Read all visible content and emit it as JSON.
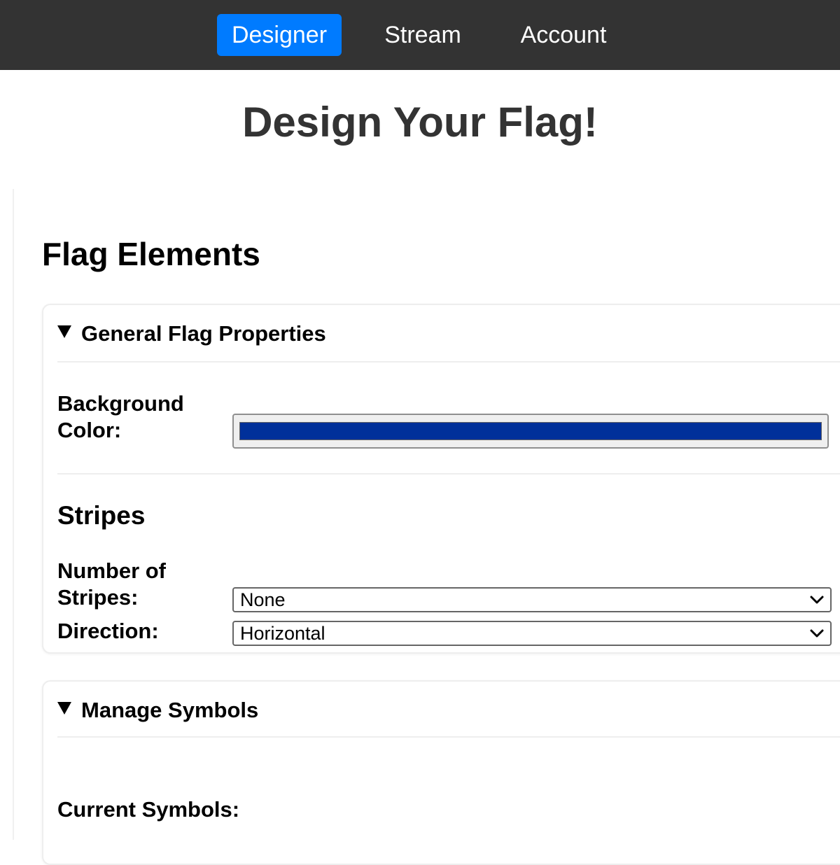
{
  "nav": {
    "items": [
      {
        "label": "Designer",
        "active": true
      },
      {
        "label": "Stream",
        "active": false
      },
      {
        "label": "Account",
        "active": false
      }
    ],
    "background": "#333333",
    "active_color": "#007bff"
  },
  "page_title": "Design Your Flag!",
  "flag_elements": {
    "title": "Flag Elements",
    "general": {
      "summary": "General Flag Properties",
      "background_color_label": "Background Color:",
      "background_color_value": "#00309a",
      "stripes": {
        "title": "Stripes",
        "number_label": "Number of Stripes:",
        "number_value": "None",
        "direction_label": "Direction:",
        "direction_value": "Horizontal"
      }
    },
    "symbols": {
      "summary": "Manage Symbols",
      "current_label": "Current Symbols:"
    }
  },
  "icons": {
    "expanded": "triangle-down-icon",
    "select": "chevron-down-icon"
  }
}
